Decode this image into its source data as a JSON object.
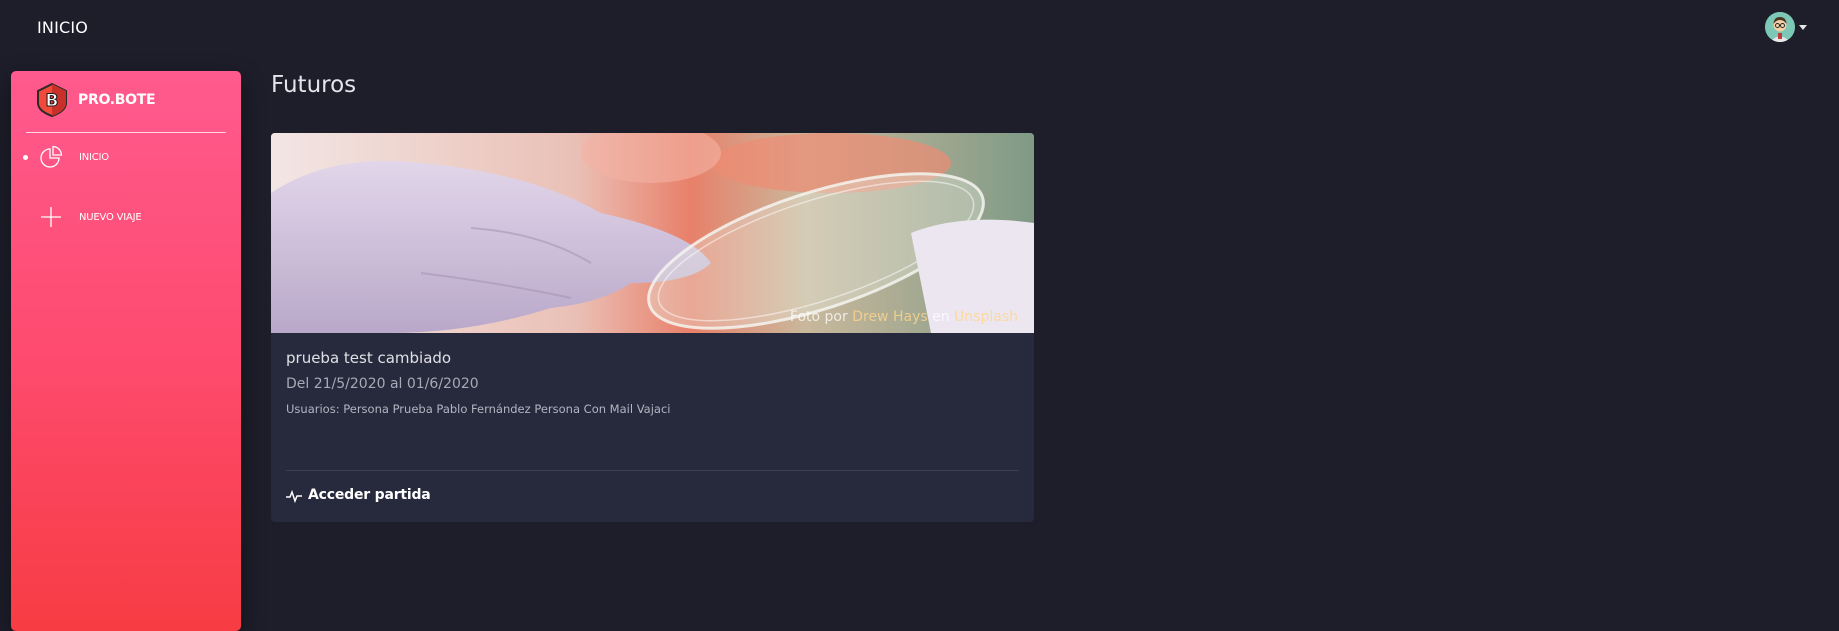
{
  "header": {
    "title": "INICIO",
    "user_menu": {
      "avatar_icon": "avatar-icon",
      "caret_icon": "caret-down-icon"
    }
  },
  "sidebar": {
    "brand": {
      "name": "PRO.BOTE",
      "logo_icon": "brand-logo-icon"
    },
    "items": [
      {
        "label": "INICIO",
        "icon": "pie-chart-icon",
        "active": true
      },
      {
        "label": "NUEVO VIAJE",
        "icon": "plus-icon",
        "active": false
      }
    ],
    "gradient": [
      "#ff5a8e",
      "#f73c43"
    ]
  },
  "main": {
    "section_title": "Futuros",
    "cards": [
      {
        "image_credit": {
          "prefix": "Foto por",
          "author": "Drew Hays",
          "middle": "en",
          "source": "Unsplash"
        },
        "title": "prueba test cambiado",
        "dates": "Del 21/5/2020 al 01/6/2020",
        "users": "Usuarios: Persona Prueba Pablo Fernández Persona Con Mail Vajaci",
        "action": {
          "label": "Acceder partida",
          "icon": "activity-icon"
        }
      }
    ]
  },
  "colors": {
    "background": "#1e1e2b",
    "card": "#27293d",
    "accent": "#fd5d93"
  }
}
